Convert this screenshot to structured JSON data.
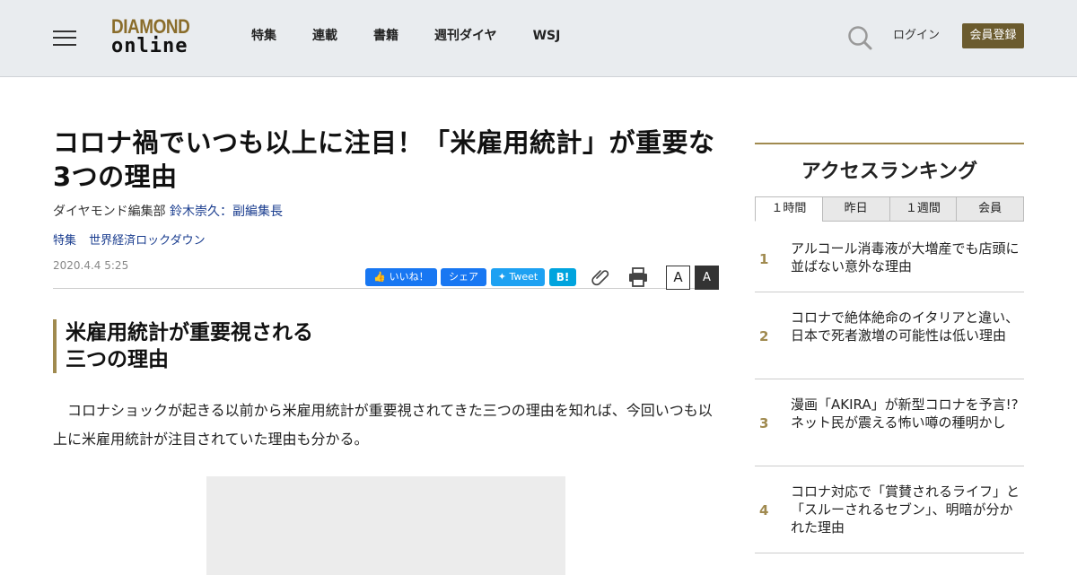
{
  "header": {
    "logo_line1": "DIAMOND",
    "logo_line2": "online",
    "nav": [
      "特集",
      "連載",
      "書籍",
      "週刊ダイヤ",
      "WSJ"
    ],
    "login": "ログイン",
    "register": "会員登録"
  },
  "article": {
    "title": "コロナ禍でいつも以上に注目！「米雇用統計」が重要な3つの理由",
    "byline_dept": "ダイヤモンド編集部",
    "byline_author": "鈴木崇久：副編集長",
    "tags": [
      "特集",
      "世界経済ロックダウン"
    ],
    "date": "2020.4.4 5:25",
    "share": {
      "like": "いいね！",
      "share": "シェア",
      "tweet": "Tweet",
      "hatena": "B!"
    },
    "font_small": "A",
    "font_large": "A",
    "section_heading_line1": "米雇用統計が重要視される",
    "section_heading_line2": "三つの理由",
    "body": "コロナショックが起きる以前から米雇用統計が重要視されてきた三つの理由を知れば、今回いつも以上に米雇用統計が注目されていた理由も分かる。"
  },
  "sidebar": {
    "ranking_title": "アクセスランキング",
    "tabs": [
      "１時間",
      "昨日",
      "１週間",
      "会員"
    ],
    "active_tab": "１時間",
    "items": [
      {
        "rank": "1",
        "text": "アルコール消毒液が大増産でも店頭に並ばない意外な理由"
      },
      {
        "rank": "2",
        "text": "コロナで絶体絶命のイタリアと違い、日本で死者激増の可能性は低い理由"
      },
      {
        "rank": "3",
        "text": "漫画「AKIRA」が新型コロナを予言!?ネット民が震える怖い噂の種明かし"
      },
      {
        "rank": "4",
        "text": "コロナ対応で「賞賛されるライフ」と「スルーされるセブン」、明暗が分かれた理由"
      }
    ]
  },
  "colors": {
    "accent_gold": "#a08a4f",
    "register_bg": "#6b5b2e",
    "link_blue": "#1a3d8f",
    "facebook": "#1877f2",
    "twitter": "#1da1f2",
    "hatena": "#00a4de"
  }
}
